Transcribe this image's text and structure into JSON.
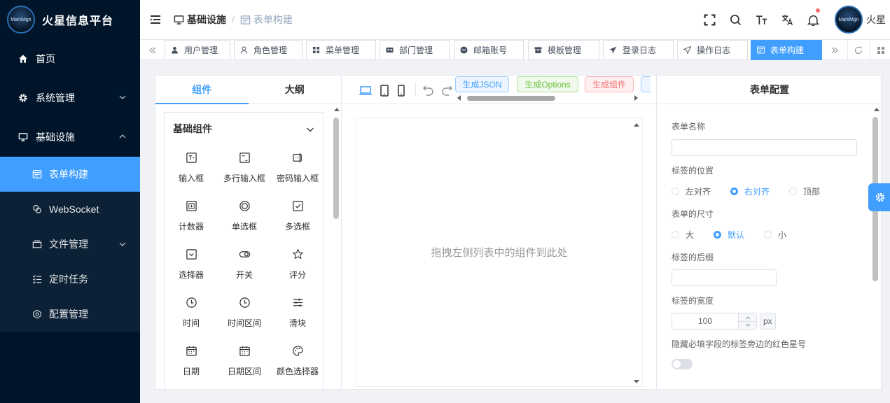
{
  "app": {
    "title": "火星信息平台",
    "logo_text": "MarsMgn"
  },
  "sidebar": {
    "items": [
      {
        "label": "首页",
        "icon": "home-icon"
      },
      {
        "label": "系统管理",
        "icon": "gear-icon",
        "expanded": false
      },
      {
        "label": "基础设施",
        "icon": "monitor-icon",
        "expanded": true
      }
    ],
    "sub_items": [
      {
        "label": "表单构建",
        "icon": "form-icon",
        "active": true
      },
      {
        "label": "WebSocket",
        "icon": "link-icon"
      },
      {
        "label": "文件管理",
        "icon": "folder-icon",
        "has_children": true
      },
      {
        "label": "定时任务",
        "icon": "task-list-icon"
      },
      {
        "label": "配置管理",
        "icon": "config-icon"
      }
    ]
  },
  "header": {
    "breadcrumb": [
      "基础设施",
      "表单构建"
    ],
    "username": "火星",
    "notification_dot_color": "#f56c6c"
  },
  "tags": [
    {
      "label": "用户管理",
      "icon": "user-icon"
    },
    {
      "label": "角色管理",
      "icon": "role-icon"
    },
    {
      "label": "菜单管理",
      "icon": "grid-icon"
    },
    {
      "label": "部门管理",
      "icon": "id-card-icon"
    },
    {
      "label": "邮箱账号",
      "icon": "mail-icon"
    },
    {
      "label": "模板管理",
      "icon": "box-icon"
    },
    {
      "label": "登录日志",
      "icon": "plane-icon"
    },
    {
      "label": "操作日志",
      "icon": "cursor-icon"
    },
    {
      "label": "表单构建",
      "icon": "form-icon",
      "active": true
    }
  ],
  "left_panel": {
    "tabs": [
      "组件",
      "大纲"
    ],
    "active_tab": "组件",
    "group_title": "基础组件",
    "components": [
      {
        "label": "输入框",
        "icon": "input-icon"
      },
      {
        "label": "多行输入框",
        "icon": "textarea-icon"
      },
      {
        "label": "密码输入框",
        "icon": "password-icon"
      },
      {
        "label": "计数器",
        "icon": "counter-icon"
      },
      {
        "label": "单选框",
        "icon": "radio-icon"
      },
      {
        "label": "多选框",
        "icon": "checkbox-icon"
      },
      {
        "label": "选择器",
        "icon": "select-icon"
      },
      {
        "label": "开关",
        "icon": "switch-icon"
      },
      {
        "label": "评分",
        "icon": "star-icon"
      },
      {
        "label": "时间",
        "icon": "clock-icon"
      },
      {
        "label": "时间区间",
        "icon": "clock-icon"
      },
      {
        "label": "滑块",
        "icon": "slider-icon"
      },
      {
        "label": "日期",
        "icon": "calendar-icon"
      },
      {
        "label": "日期区间",
        "icon": "calendar-icon"
      },
      {
        "label": "颜色选择器",
        "icon": "palette-icon"
      }
    ]
  },
  "toolbar": {
    "gen_json": "生成JSON",
    "gen_options": "生成Options",
    "gen_component": "生成组件"
  },
  "canvas": {
    "placeholder": "拖拽左侧列表中的组件到此处"
  },
  "form_config": {
    "title": "表单配置",
    "form_name_label": "表单名称",
    "form_name_value": "",
    "label_position_label": "标签的位置",
    "label_position_options": [
      "左对齐",
      "右对齐",
      "顶部"
    ],
    "label_position_selected": "右对齐",
    "form_size_label": "表单的尺寸",
    "form_size_options": [
      "大",
      "默认",
      "小"
    ],
    "form_size_selected": "默认",
    "label_suffix_label": "标签的后缀",
    "label_suffix_value": "",
    "label_width_label": "标签的宽度",
    "label_width_value": "100",
    "label_width_unit": "px",
    "hide_asterisk_label": "隐藏必填字段的标签旁边的红色星号",
    "hide_asterisk_value": false
  },
  "colors": {
    "accent": "#409eff",
    "sidebar_bg": "#001529",
    "json_btn": "#409eff",
    "options_btn": "#67c23a",
    "component_btn": "#f56c6c"
  }
}
